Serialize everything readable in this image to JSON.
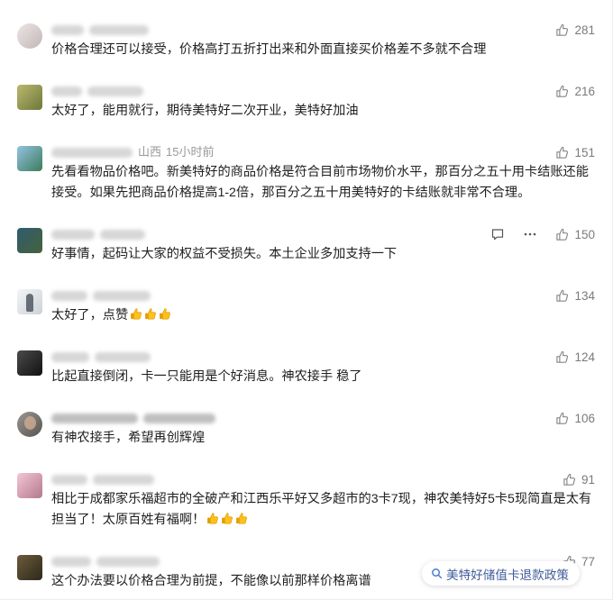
{
  "comments": [
    {
      "avatar_colors": [
        "#ece5e5",
        "#c2b6b6"
      ],
      "text": "价格合理还可以接受，价格高打五折打出来和外面直接买价格差不多就不合理",
      "likes": 281
    },
    {
      "avatar_colors": [
        "#bcb86e",
        "#6d783a"
      ],
      "text": "太好了，能用就行，期待美特好二次开业，美特好加油",
      "likes": 216
    },
    {
      "avatar_colors": [
        "#93c3e2",
        "#3d7b5a"
      ],
      "region": "山西",
      "time": "15小时前",
      "text": "先看看物品价格吧。新美特好的商品价格是符合目前市场物价水平，那百分之五十用卡结账还能接受。如果先把商品价格提高1-2倍，那百分之五十用美特好的卡结账就非常不合理。",
      "likes": 151
    },
    {
      "avatar_colors": [
        "#2f5b70",
        "#46623a"
      ],
      "text": "好事情，起码让大家的权益不受损失。本土企业多加支持一下",
      "likes": 150,
      "action_icons": [
        "comment-icon",
        "more-icon"
      ]
    },
    {
      "avatar_colors": [
        "#f3f5f6",
        "#cbd2d6"
      ],
      "text": "太好了，点赞",
      "emoji": [
        "thumbs-up",
        "thumbs-up",
        "thumbs-up"
      ],
      "likes": 134
    },
    {
      "avatar_colors": [
        "#4b4b4b",
        "#111111"
      ],
      "text": "比起直接倒闭，卡一只能用是个好消息。神农接手 稳了",
      "likes": 124
    },
    {
      "avatar_colors": [
        "#9b9691",
        "#57534f"
      ],
      "text": "有神农接手，希望再创辉煌",
      "likes": 106
    },
    {
      "avatar_colors": [
        "#f2c7d4",
        "#b4798d"
      ],
      "text": "相比于成都家乐福超市的全破产和江西乐平好又多超市的3卡7现，神农美特好5卡5现简直是太有担当了！太原百姓有福啊！",
      "emoji": [
        "thumbs-up",
        "thumbs-up",
        "thumbs-up"
      ],
      "likes": 91
    },
    {
      "avatar_colors": [
        "#6c5b3b",
        "#2d291b"
      ],
      "text": "这个办法要以价格合理为前提，不能像以前那样价格离谱",
      "likes": 77
    }
  ],
  "like_icon": "thumbs-up-icon",
  "search_suggestion": {
    "icon": "search-icon",
    "label": "美特好储值卡退款政策"
  },
  "colors": {
    "text": "#1f1f1f",
    "meta": "#999999",
    "like": "#7a7a7a",
    "suggestion_text": "#3e5c9a",
    "search_icon": "#4a7bd0",
    "emoji_yellow": "#fcc21b"
  }
}
